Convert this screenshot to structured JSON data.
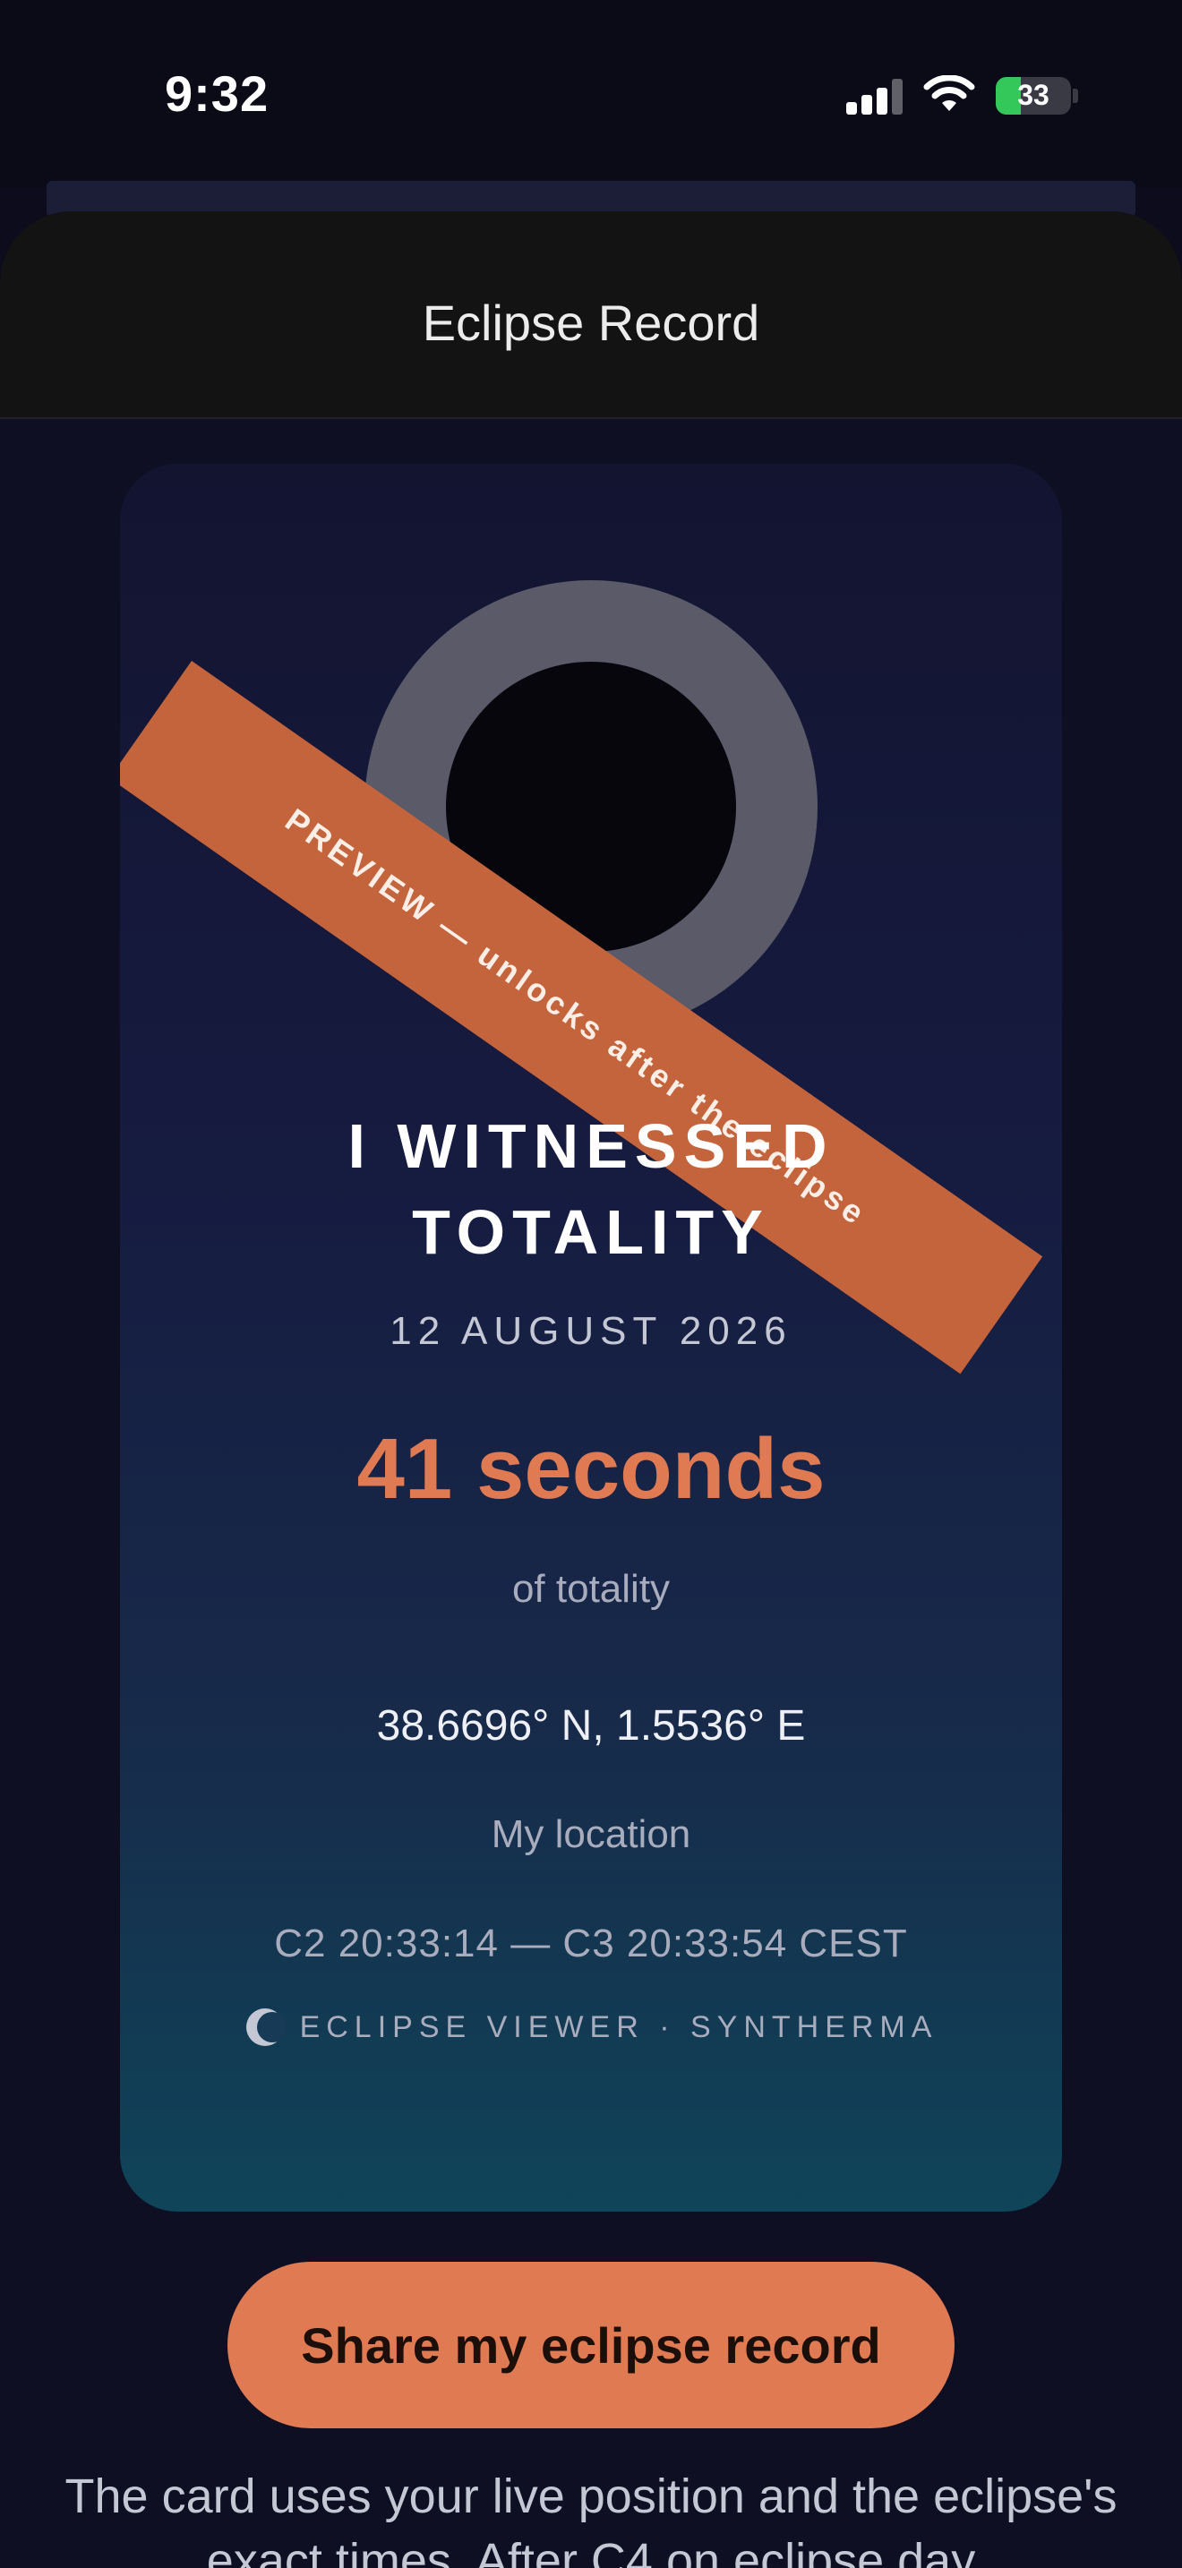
{
  "status_bar": {
    "time": "9:32",
    "battery_level": "33",
    "battery_fraction": 0.33
  },
  "sheet": {
    "title": "Eclipse Record"
  },
  "card": {
    "ribbon_text": "PREVIEW — unlocks after the eclipse",
    "headline_line1": "I WITNESSED",
    "headline_line2": "TOTALITY",
    "date": "12 AUGUST 2026",
    "duration": "41 seconds",
    "duration_caption": "of totality",
    "coordinates": "38.6696° N, 1.5536° E",
    "location_label": "My location",
    "contact_times": "C2 20:33:14 — C3 20:33:54 CEST",
    "brand": "ECLIPSE VIEWER · SYNTHERMA"
  },
  "actions": {
    "share_label": "Share my eclipse record"
  },
  "footnote": "The card uses your live position and the eclipse's exact times. After C4 on eclipse day",
  "colors": {
    "accent": "#e07a52",
    "ribbon": "#c4643c",
    "background": "#0f0f24",
    "battery": "#34c759"
  },
  "icons": [
    "signal-icon",
    "wifi-icon",
    "battery-icon",
    "eclipse-logo-icon"
  ]
}
